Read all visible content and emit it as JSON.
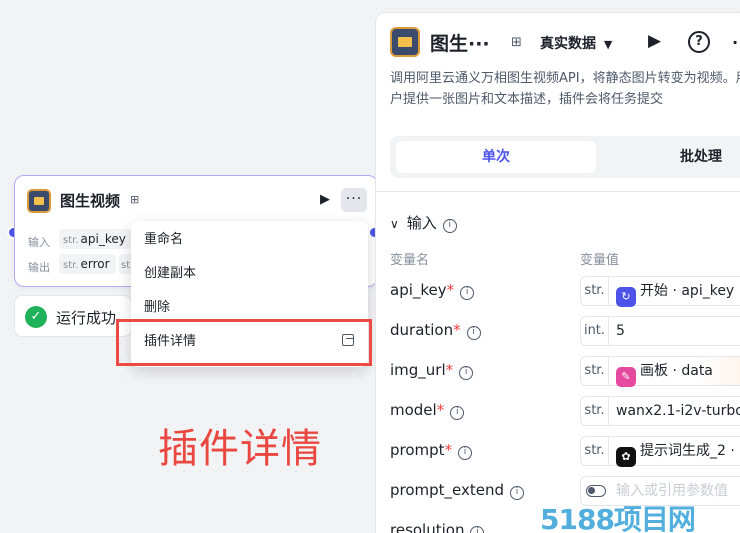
{
  "node": {
    "title": "图生视频",
    "input_label": "输入",
    "output_label": "输出",
    "input_tag_type": "str.",
    "input_tag_name": "api_key",
    "output_tag_type": "str.",
    "output_tag_name": "error",
    "output_tag2_type": "str",
    "more_label": "···"
  },
  "status": {
    "text": "运行成功"
  },
  "menu": {
    "items": [
      "重命名",
      "创建副本",
      "删除",
      "插件详情"
    ]
  },
  "annotation": {
    "label": "插件详情"
  },
  "panel": {
    "title": "图生···",
    "data_mode": "真实数据",
    "description": "调用阿里云通义万相图生视频API，将静态图片转变为视频。用户提供一张图片和文本描述，插件会将任务提交",
    "tabs": [
      "单次",
      "批处理"
    ],
    "section_title": "输入",
    "col_name": "变量名",
    "col_value": "变量值",
    "rows": [
      {
        "name": "api_key",
        "required": "*",
        "type": "str.",
        "value": "开始 · api_key",
        "chip": "#4d53e8",
        "chip_glyph": "↻"
      },
      {
        "name": "duration",
        "required": "*",
        "type": "int.",
        "value": "5",
        "chip": "",
        "chip_glyph": ""
      },
      {
        "name": "img_url",
        "required": "*",
        "type": "str.",
        "value": "画板 · data",
        "chip": "#e64a9f",
        "chip_glyph": "✎"
      },
      {
        "name": "model",
        "required": "*",
        "type": "str.",
        "value": "wanx2.1-i2v-turbo",
        "chip": "",
        "chip_glyph": ""
      },
      {
        "name": "prompt",
        "required": "*",
        "type": "str.",
        "value": "提示词生成_2 · ",
        "chip": "#111111",
        "chip_glyph": "✿"
      },
      {
        "name": "prompt_extend",
        "required": "",
        "type": "",
        "value": "输入或引用参数值",
        "chip": "",
        "chip_glyph": ""
      },
      {
        "name": "resolution",
        "required": "",
        "type": "",
        "value": "",
        "chip": "",
        "chip_glyph": ""
      }
    ]
  },
  "watermark": {
    "text": "5188项目网"
  }
}
